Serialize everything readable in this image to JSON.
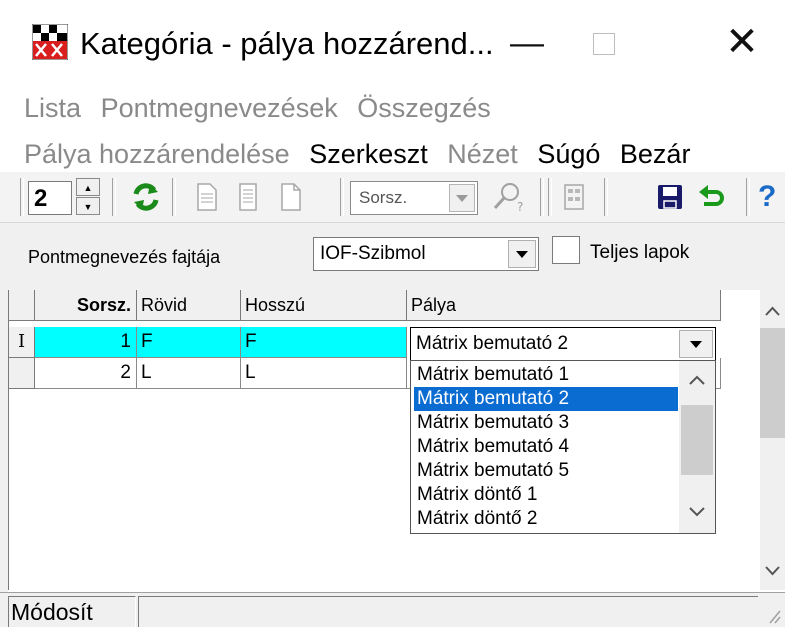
{
  "window": {
    "title": "Kategória - pálya hozzárend...",
    "minimize_glyph": "—",
    "close_glyph": "✕"
  },
  "menu": {
    "row1": [
      {
        "label": "Lista",
        "enabled": false
      },
      {
        "label": "Pontmegnevezések",
        "enabled": false
      },
      {
        "label": "Összegzés",
        "enabled": false
      }
    ],
    "row2": [
      {
        "label": "Pálya hozzárendelése",
        "enabled": false
      },
      {
        "label": "Szerkeszt",
        "enabled": true
      },
      {
        "label": "Nézet",
        "enabled": false
      },
      {
        "label": "Súgó",
        "enabled": true
      },
      {
        "label": "Bezár",
        "enabled": true
      }
    ]
  },
  "toolbar": {
    "spin_value": "2",
    "spin_up_icon": "triangle-up-icon",
    "spin_down_icon": "triangle-down-icon",
    "search_combo_placeholder": "Sorsz.",
    "help_glyph": "?"
  },
  "filter": {
    "label": "Pontmegnevezés fajtája",
    "combo_value": "IOF-Szibmol",
    "checkbox_label": "Teljes lapok",
    "checkbox_checked": false
  },
  "grid": {
    "columns": [
      "Sorsz.",
      "Rövid",
      "Hosszú",
      "Pálya"
    ],
    "rows": [
      {
        "indicator": "I",
        "sorsz": "1",
        "rovid": "F",
        "hosszu": "F",
        "palya": "Mátrix bemutató 2"
      },
      {
        "indicator": "",
        "sorsz": "2",
        "rovid": "L",
        "hosszu": "L",
        "palya": ""
      }
    ]
  },
  "dropdown": {
    "selected": "Mátrix bemutató 2",
    "options": [
      "Mátrix bemutató 1",
      "Mátrix bemutató 2",
      "Mátrix bemutató 3",
      "Mátrix bemutató 4",
      "Mátrix bemutató 5",
      "Mátrix döntő 1",
      "Mátrix döntő 2"
    ]
  },
  "status": {
    "text": "Módosít"
  },
  "colors": {
    "selected_row": "#00ffff",
    "highlight": "#0a6bd0",
    "disabled_text": "#8a8a8a"
  }
}
